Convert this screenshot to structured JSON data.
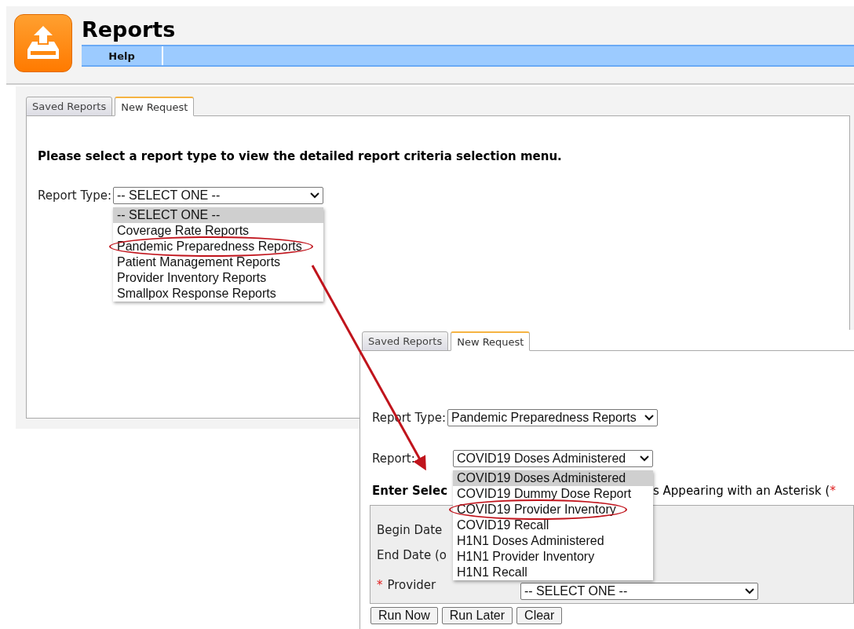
{
  "header": {
    "title": "Reports",
    "nav": [
      {
        "label": "Help"
      }
    ]
  },
  "first_screen": {
    "tabs": [
      {
        "label": "Saved Reports",
        "selected": false
      },
      {
        "label": "New Request",
        "selected": true
      }
    ],
    "prompt": "Please select a report type to view the detailed report criteria selection menu.",
    "report_type": {
      "label": "Report Type:",
      "value": "-- SELECT ONE --",
      "options": [
        {
          "label": "-- SELECT ONE --",
          "selected": true,
          "circled": false
        },
        {
          "label": "Coverage Rate Reports",
          "selected": false,
          "circled": false
        },
        {
          "label": "Pandemic Preparedness Reports",
          "selected": false,
          "circled": true
        },
        {
          "label": "Patient Management Reports",
          "selected": false,
          "circled": false
        },
        {
          "label": "Provider Inventory Reports",
          "selected": false,
          "circled": false
        },
        {
          "label": "Smallpox Response Reports",
          "selected": false,
          "circled": false
        }
      ]
    }
  },
  "second_screen": {
    "tabs": [
      {
        "label": "Saved Reports",
        "selected": false
      },
      {
        "label": "New Request",
        "selected": true
      }
    ],
    "report_type": {
      "label": "Report Type:",
      "value": "Pandemic Preparedness Reports"
    },
    "report": {
      "label": "Report:",
      "value": "COVID19 Doses Administered",
      "options": [
        {
          "label": "COVID19 Doses Administered",
          "selected": true,
          "circled": false
        },
        {
          "label": "COVID19 Dummy Dose Report",
          "selected": false,
          "circled": false
        },
        {
          "label": "COVID19 Provider Inventory",
          "selected": false,
          "circled": true
        },
        {
          "label": "COVID19 Recall",
          "selected": false,
          "circled": false
        },
        {
          "label": "H1N1 Doses Administered",
          "selected": false,
          "circled": false
        },
        {
          "label": "H1N1 Provider Inventory",
          "selected": false,
          "circled": false
        },
        {
          "label": "H1N1 Recall",
          "selected": false,
          "circled": false
        }
      ]
    },
    "instruction_start": "Enter Selec",
    "instruction_end": "s Appearing with an Asterisk (",
    "required_mark": "*",
    "fields": [
      {
        "label": "Begin Date",
        "required": false
      },
      {
        "label": "End Date (o",
        "required": false
      },
      {
        "label": "Provider",
        "required": true,
        "value": "-- SELECT ONE --"
      }
    ],
    "buttons": [
      "Run Now",
      "Run Later",
      "Clear"
    ]
  }
}
